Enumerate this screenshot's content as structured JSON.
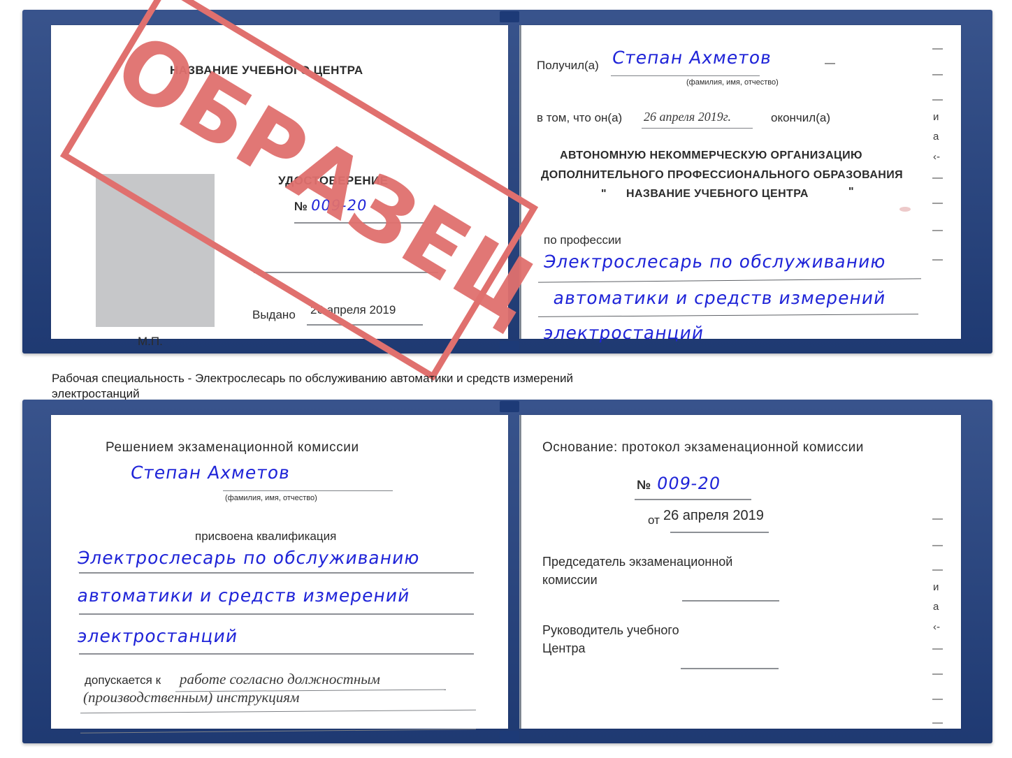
{
  "document": {
    "type": "Удостоверение",
    "watermark": "ОБРАЗЕЦ",
    "accent_blue": "#22407f",
    "handwriting_blue": "#1f24d8",
    "stamp_red": "#e0706e"
  },
  "caption": {
    "line1": "Рабочая специальность - Электрослесарь по обслуживанию автоматики и средств измерений",
    "line2": "электростанций"
  },
  "top_certificate": {
    "left_page": {
      "center_name": "НАЗВАНИЕ УЧЕБНОГО ЦЕНТРА",
      "title": "УДОСТОВЕРЕНИЕ",
      "number_label": "№",
      "number_value": "009-20",
      "issued_label": "Выдано",
      "issued_value": "26 апреля 2019",
      "seal_label": "М.П.",
      "photo_placeholder": "photo-box"
    },
    "right_page": {
      "received_label": "Получил(а)",
      "received_value": "Степан Ахметов",
      "fio_hint": "(фамилия, имя, отчество)",
      "that_he_label": "в том, что он(а)",
      "that_he_date": "26 апреля 2019г.",
      "finished_label": "окончил(а)",
      "org_line1": "АВТОНОМНУЮ НЕКОММЕРЧЕСКУЮ ОРГАНИЗАЦИЮ",
      "org_line2": "ДОПОЛНИТЕЛЬНОГО ПРОФЕССИОНАЛЬНОГО ОБРАЗОВАНИЯ",
      "org_quote_open": "\"",
      "org_line3": "НАЗВАНИЕ УЧЕБНОГО ЦЕНТРА",
      "org_quote_close": "\"",
      "profession_label": "по профессии",
      "profession_line1": "Электрослесарь по обслуживанию",
      "profession_line2": "автоматики и средств измерений",
      "profession_line3": "электростанций",
      "edge_fragments": [
        "—",
        "—",
        "—",
        "и",
        "а",
        "‹-",
        "—",
        "—",
        "—",
        "—"
      ]
    }
  },
  "bottom_certificate": {
    "left_page": {
      "decision_title": "Решением экзаменационной комиссии",
      "name_value": "Степан Ахметов",
      "fio_hint": "(фамилия, имя, отчество)",
      "qualification_label": "присвоена квалификация",
      "qualification_line1": "Электрослесарь по обслуживанию",
      "qualification_line2": "автоматики и средств измерений",
      "qualification_line3": "электростанций",
      "admitted_label": "допускается к",
      "admitted_value_line1": "работе согласно должностным",
      "admitted_value_line2": "(производственным) инструкциям"
    },
    "right_page": {
      "basis_label": "Основание: протокол экзаменационной комиссии",
      "number_label": "№",
      "number_value": "009-20",
      "date_label": "от",
      "date_value": "26 апреля 2019",
      "chairman_line1": "Председатель экзаменационной",
      "chairman_line2": "комиссии",
      "head_line1": "Руководитель учебного",
      "head_line2": "Центра",
      "edge_fragments": [
        "—",
        "—",
        "—",
        "и",
        "а",
        "‹-",
        "—",
        "—",
        "—",
        "—"
      ]
    }
  }
}
